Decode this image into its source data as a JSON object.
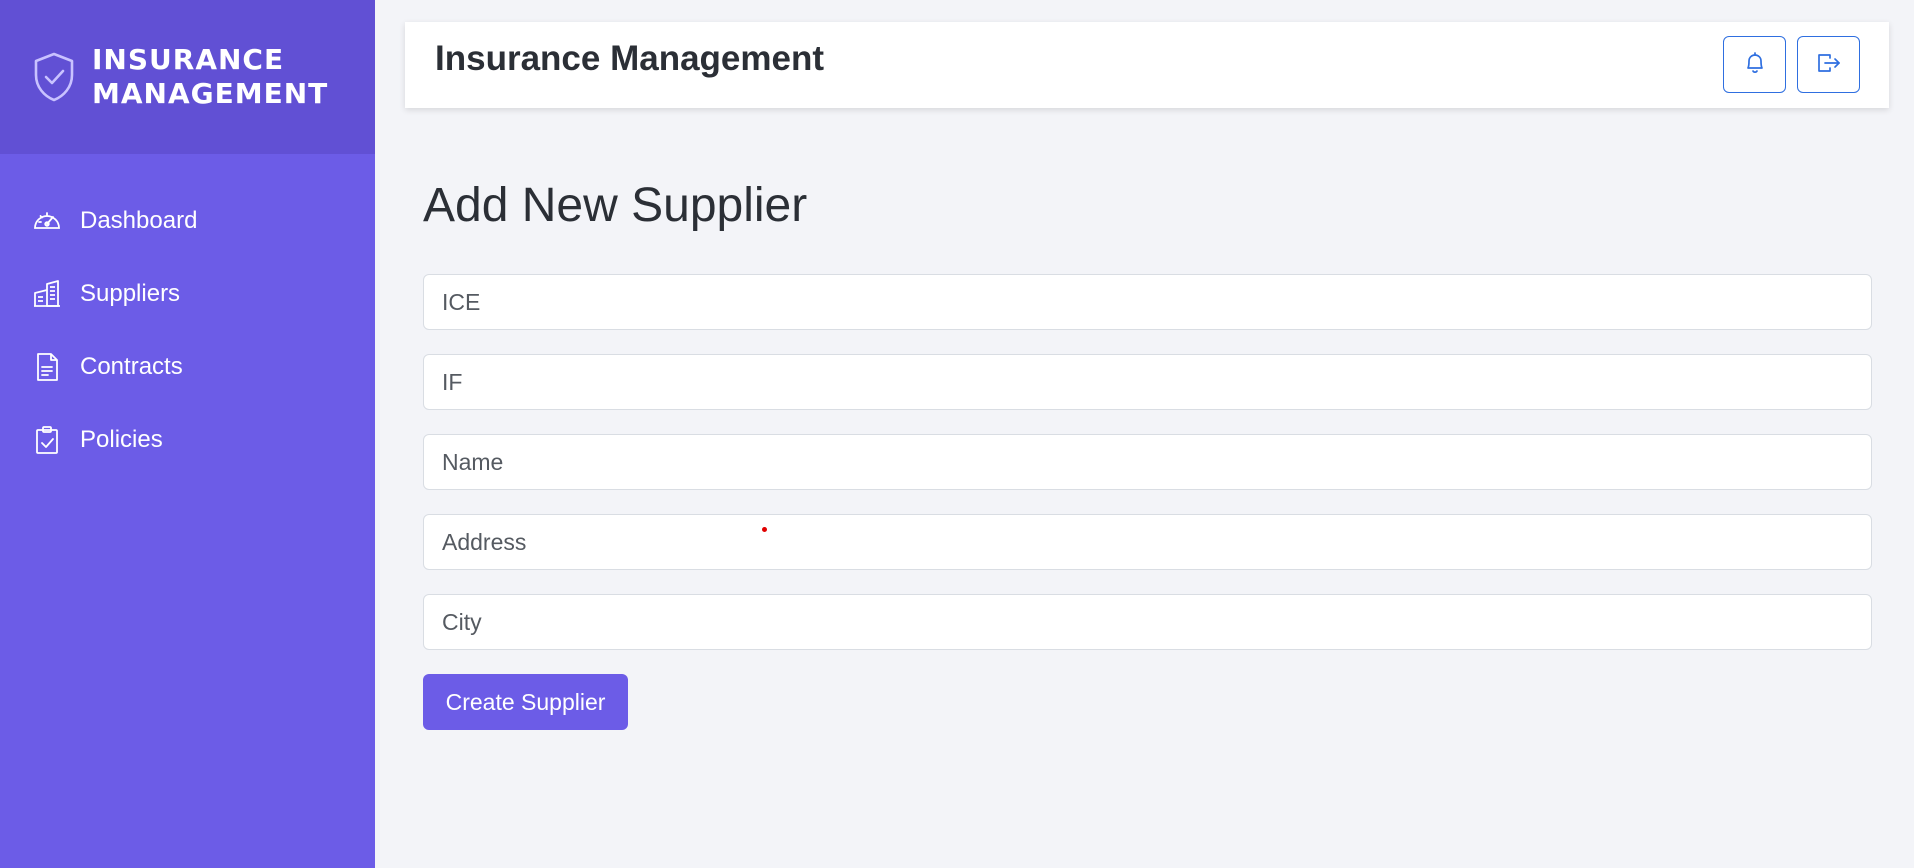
{
  "brand": {
    "line1": "INSURANCE",
    "line2": "MANAGEMENT",
    "icon": "shield-check-icon"
  },
  "sidebar": {
    "items": [
      {
        "label": "Dashboard",
        "icon": "speedometer-icon"
      },
      {
        "label": "Suppliers",
        "icon": "buildings-icon"
      },
      {
        "label": "Contracts",
        "icon": "document-icon"
      },
      {
        "label": "Policies",
        "icon": "clipboard-check-icon"
      }
    ]
  },
  "header": {
    "title": "Insurance Management",
    "buttons": [
      {
        "icon": "bell-icon"
      },
      {
        "icon": "logout-icon"
      }
    ]
  },
  "form": {
    "heading": "Add New Supplier",
    "fields": [
      {
        "placeholder": "ICE",
        "value": ""
      },
      {
        "placeholder": "IF",
        "value": ""
      },
      {
        "placeholder": "Name",
        "value": ""
      },
      {
        "placeholder": "Address",
        "value": ""
      },
      {
        "placeholder": "City",
        "value": ""
      }
    ],
    "submit_label": "Create Supplier"
  },
  "colors": {
    "sidebar": "#6c5ce7",
    "brand_bg": "#6150d4",
    "accent_blue": "#2f6fe0",
    "page_bg": "#f3f4f8"
  }
}
